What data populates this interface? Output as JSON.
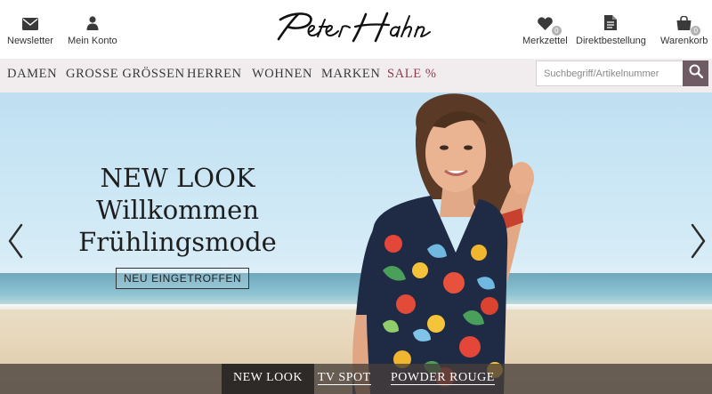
{
  "header": {
    "utilities": {
      "newsletter": "Newsletter",
      "account": "Mein Konto",
      "wishlist": "Merkzettel",
      "wishlist_count": "0",
      "direct_order": "Direktbestellung",
      "cart": "Warenkorb",
      "cart_count": "0"
    },
    "logo_text": "Peter Hahn"
  },
  "nav": {
    "items": [
      "DAMEN",
      "GROSSE GRÖSSEN",
      "HERREN",
      "WOHNEN",
      "MARKEN",
      "SALE %"
    ],
    "sale_color": "#8e3a4e"
  },
  "search": {
    "placeholder": "Suchbegriff/Artikelnummer",
    "value": "",
    "button_color": "#6f5b64"
  },
  "hero": {
    "line1": "NEW LOOK",
    "line2": "Willkommen",
    "line3": "Frühlingsmode",
    "cta": "NEU EINGETROFFEN"
  },
  "slides": {
    "tabs": [
      "NEW LOOK",
      "TV SPOT",
      "POWDER ROUGE"
    ],
    "active_index": 0
  },
  "icons": [
    "envelope-icon",
    "user-icon",
    "heart-icon",
    "document-icon",
    "shopping-bag-icon",
    "search-icon",
    "chevron-left-icon",
    "chevron-right-icon"
  ]
}
